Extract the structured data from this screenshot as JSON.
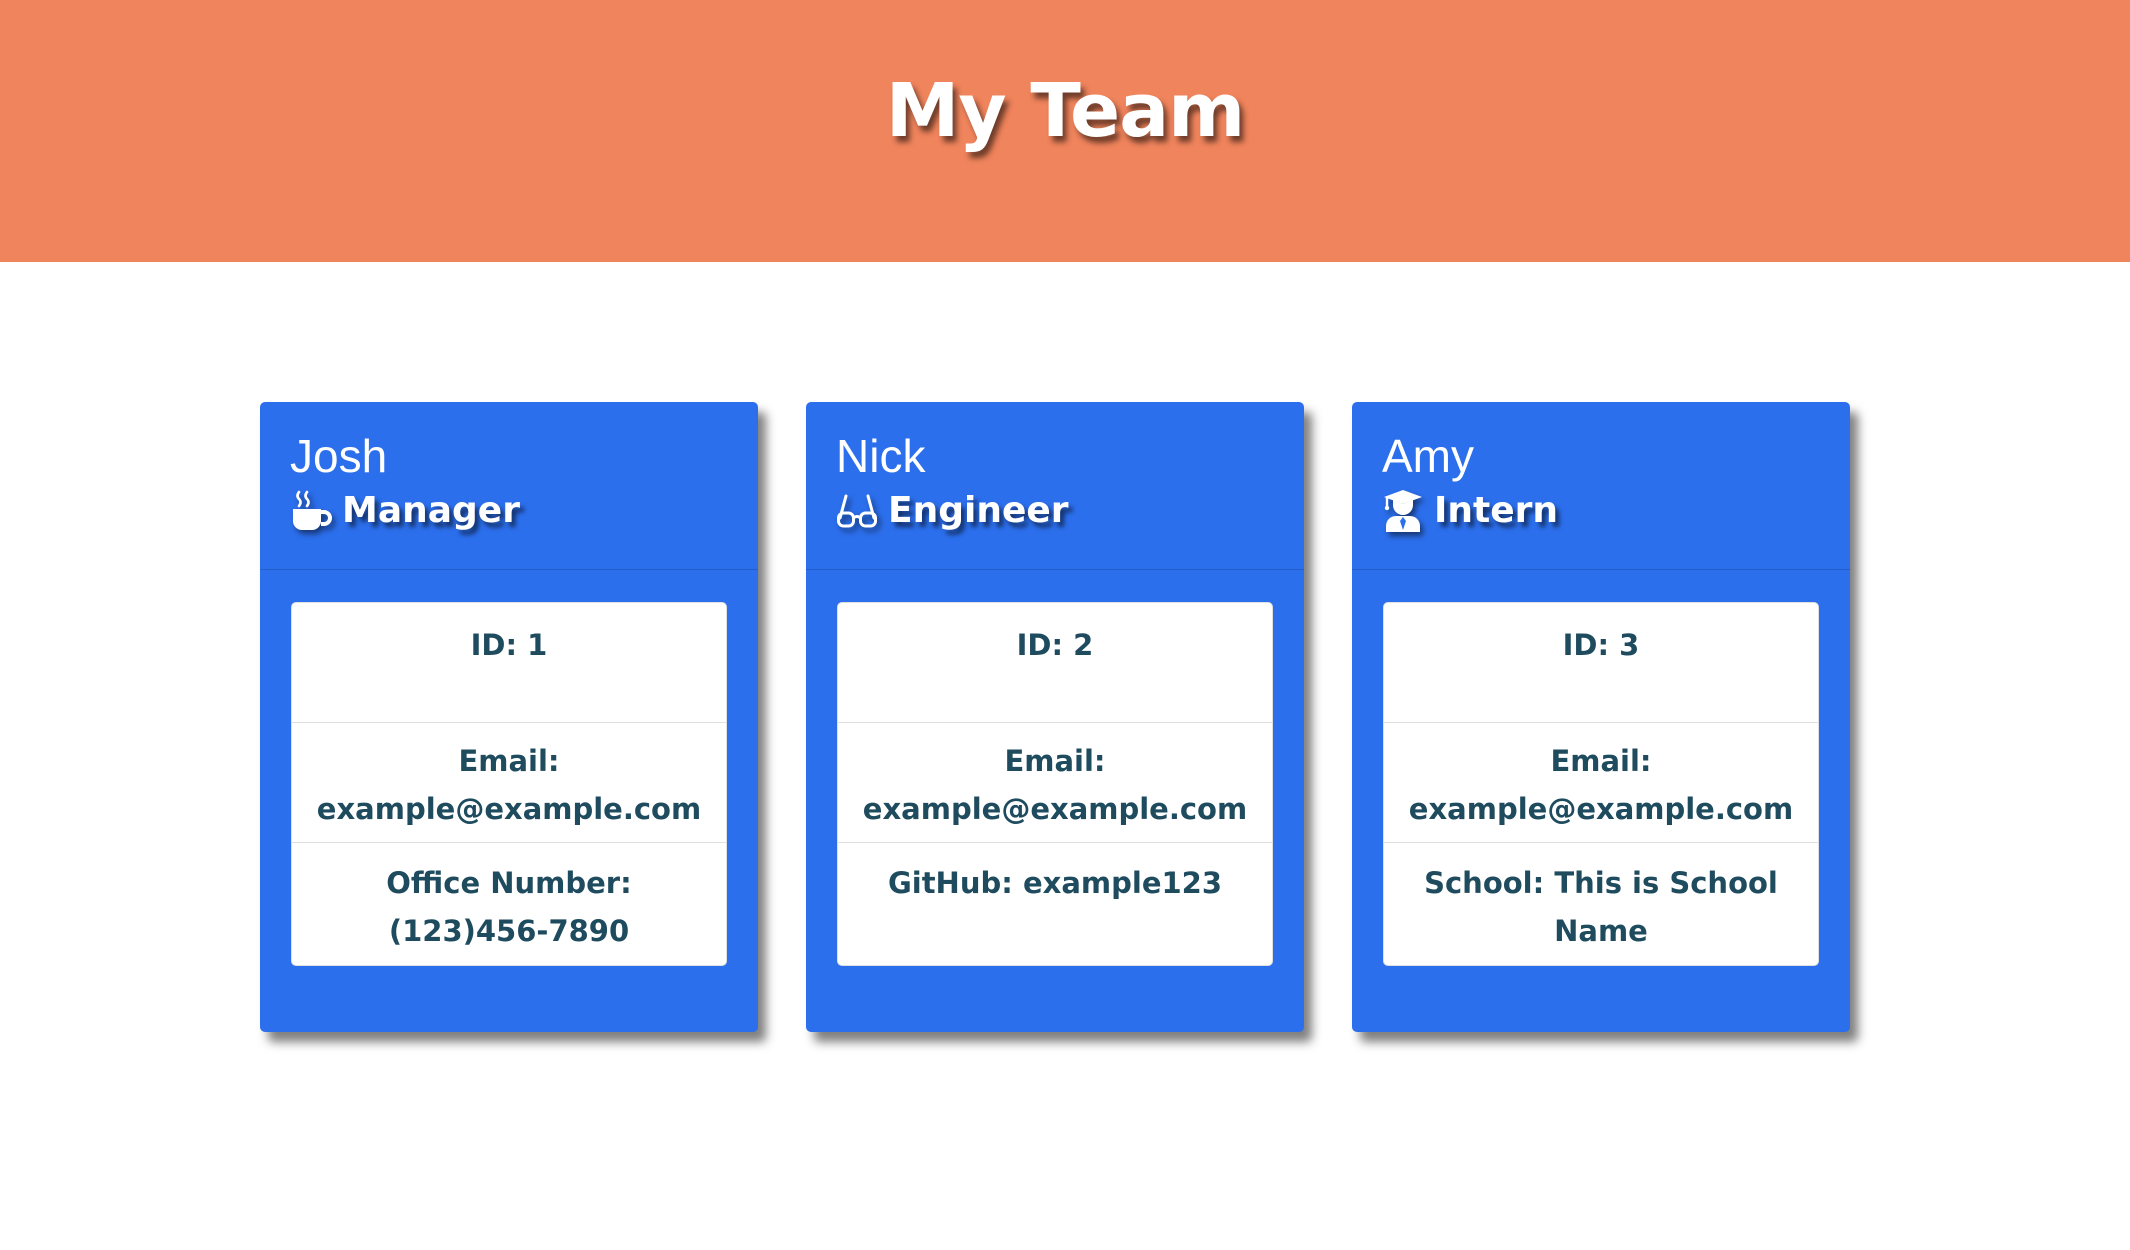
{
  "header": {
    "title": "My Team"
  },
  "colors": {
    "header_bg": "#f0845c",
    "card_bg": "#2c6fed",
    "text_dark": "#1f4b5f"
  },
  "team": [
    {
      "name": "Josh",
      "role": "Manager",
      "role_icon": "mug-hot-icon",
      "id": "ID: 1",
      "email_label": "Email:",
      "email": "example@example.com",
      "extra_label": "Office Number:",
      "extra_value": "(123)456-7890"
    },
    {
      "name": "Nick",
      "role": "Engineer",
      "role_icon": "glasses-icon",
      "id": "ID: 2",
      "email_label": "Email:",
      "email": "example@example.com",
      "extra_label": "GitHub:",
      "extra_value": "example123"
    },
    {
      "name": "Amy",
      "role": "Intern",
      "role_icon": "graduate-icon",
      "id": "ID: 3",
      "email_label": "Email:",
      "email": "example@example.com",
      "extra_label": "School:",
      "extra_value": "This is School Name"
    }
  ]
}
